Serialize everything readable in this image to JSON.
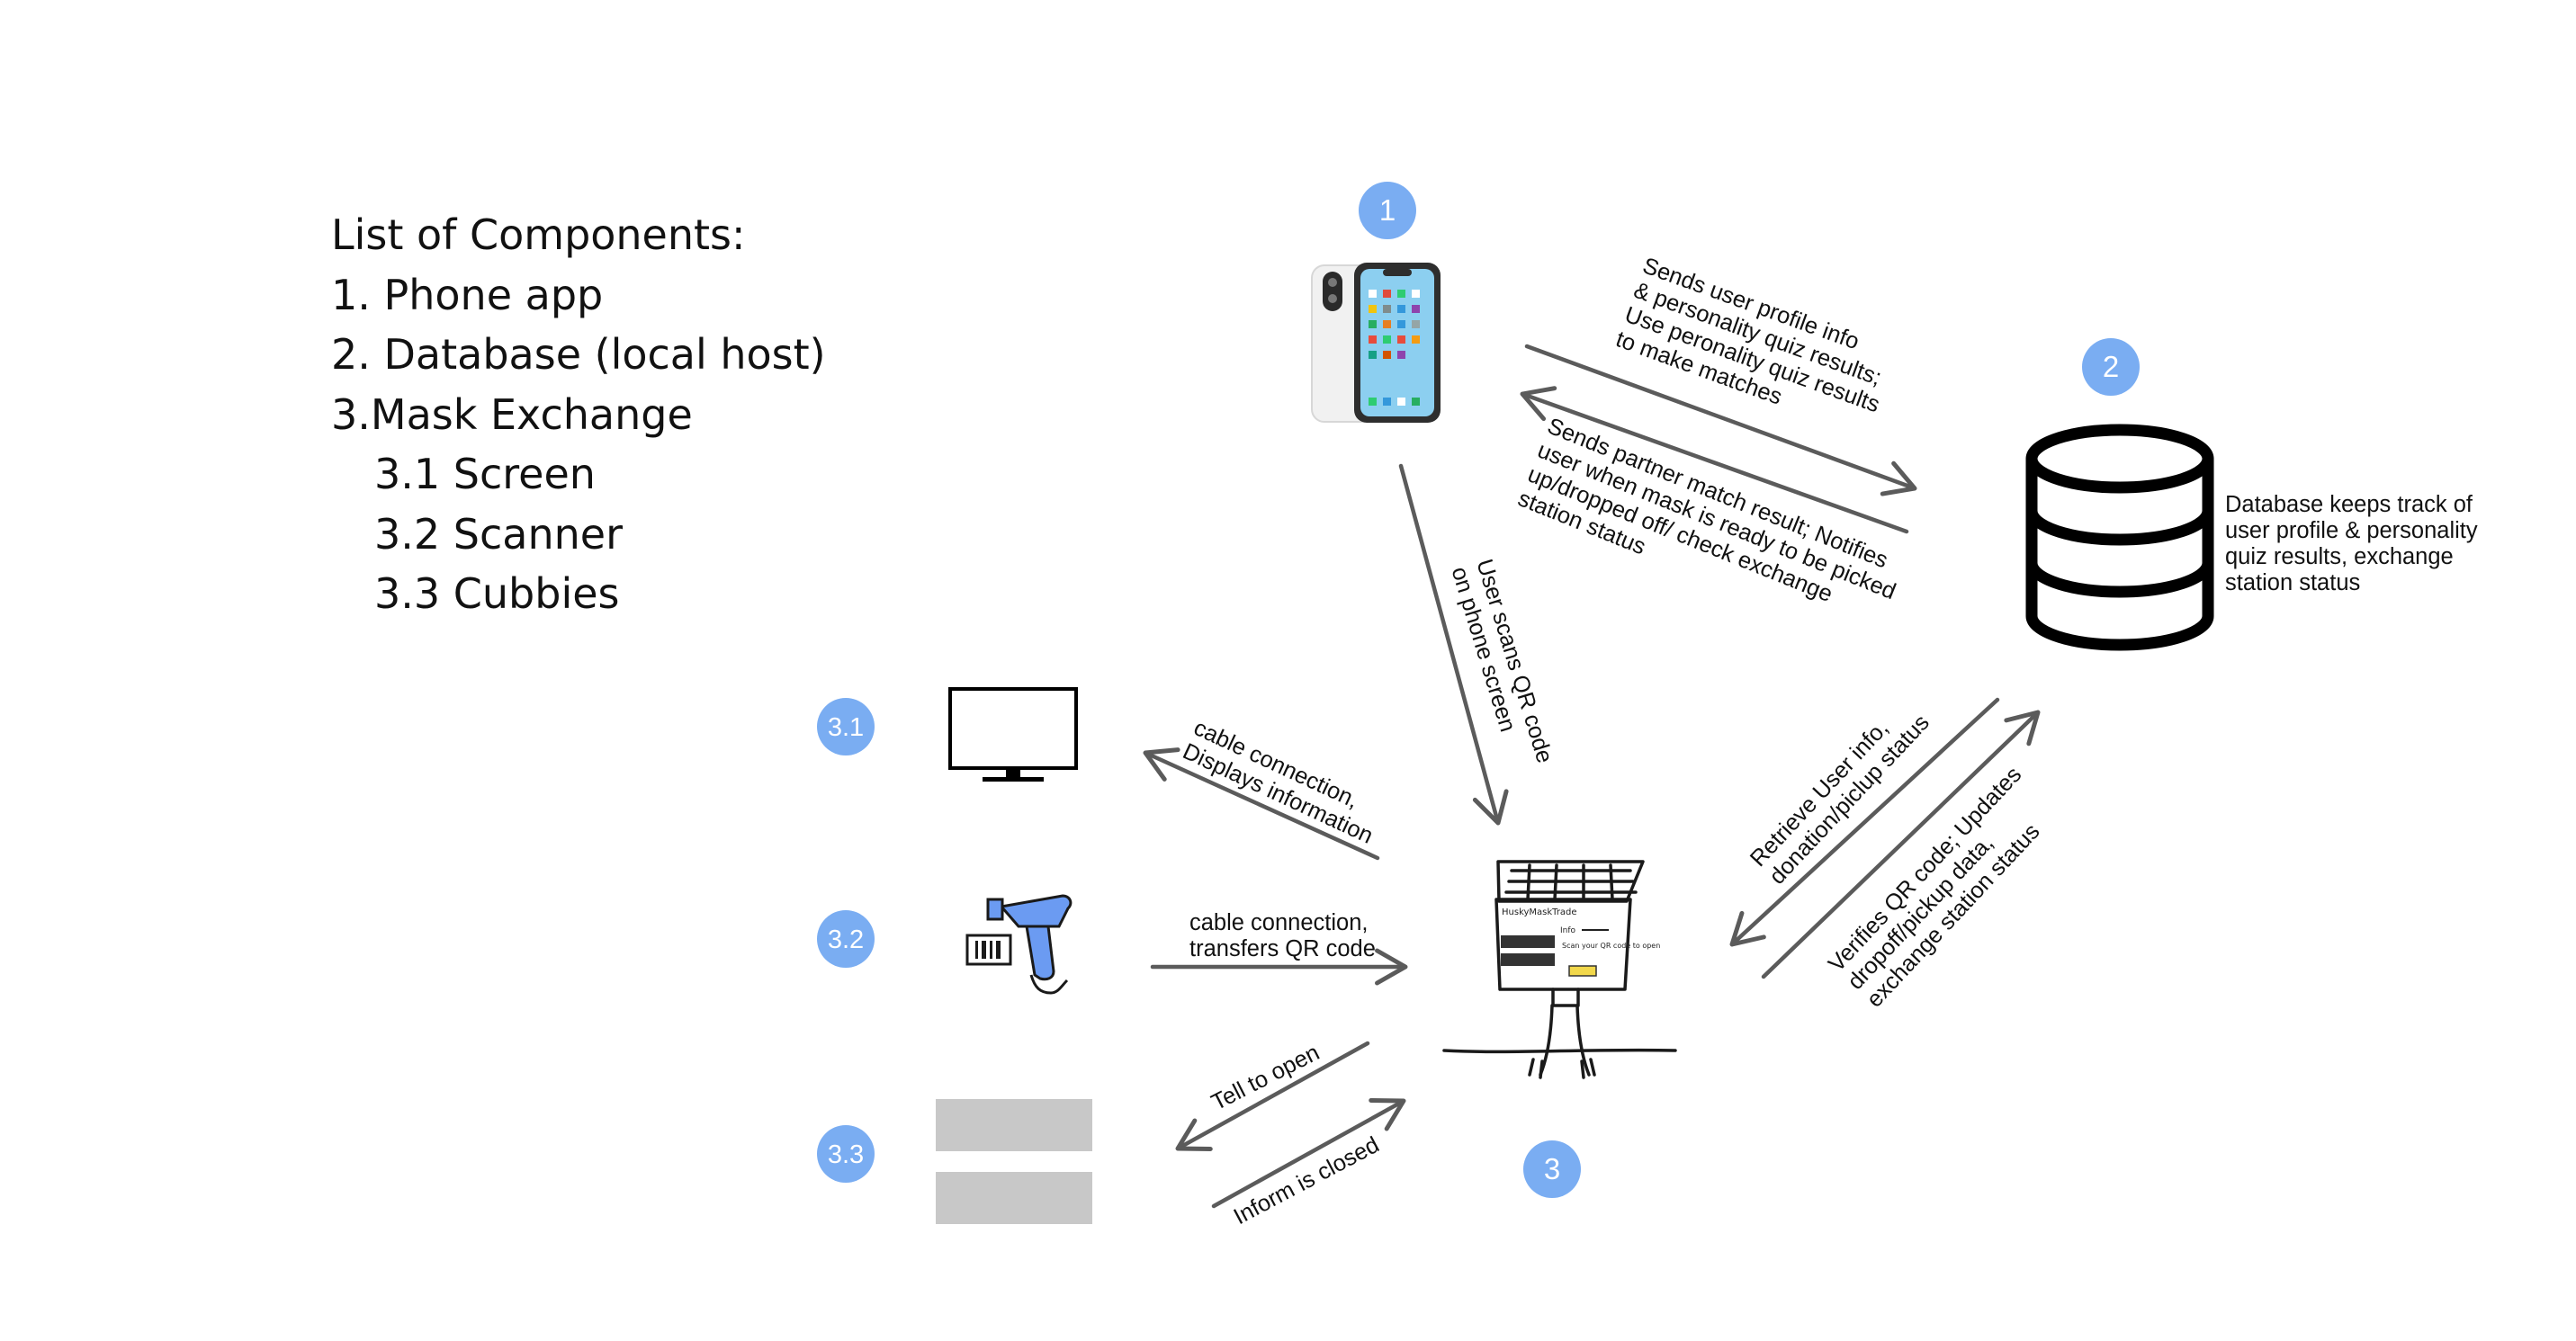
{
  "components": {
    "heading": "List of Components:",
    "items": [
      "1. Phone app",
      "2. Database (local host)",
      "3.Mask Exchange",
      "3.1 Screen",
      "3.2 Scanner",
      "3.3 Cubbies"
    ]
  },
  "badges": {
    "phone": "1",
    "database": "2",
    "exchange": "3",
    "screen": "3.1",
    "scanner": "3.2",
    "cubbies": "3.3"
  },
  "exchange_sign": {
    "title": "HuskyMaskTrade",
    "info": "Info",
    "scan": "Scan your QR code to open"
  },
  "labels": {
    "phone_to_db": [
      "Sends user profile info",
      "& personality quiz results;",
      "Use peronality quiz results",
      "to make matches"
    ],
    "db_to_phone": [
      "Sends partner match result; Notifies",
      "user when mask is ready to be picked",
      "up/dropped off/ check exchange",
      "station status"
    ],
    "db_note": [
      "Database keeps track of",
      "user profile & personality",
      "quiz results, exchange",
      "station status"
    ],
    "phone_to_exchange": [
      "User scans QR code",
      "on phone screen"
    ],
    "db_to_exchange": [
      "Retrieve User info,",
      "donation/piclup status"
    ],
    "exchange_to_db": [
      "Verifies QR code; Updates",
      "dropoff/pickup data,",
      "exchange station status"
    ],
    "exchange_to_screen": [
      "cable connection,",
      "Displays information"
    ],
    "scanner_to_exchange": [
      "cable connection,",
      "transfers QR code"
    ],
    "exchange_to_cubbies": [
      "Tell to open"
    ],
    "cubbies_to_exchange": [
      "Inform is closed"
    ]
  },
  "colors": {
    "badge": "#7aadf2",
    "arrow": "#5b5b5b",
    "cubby": "#c8c8c8",
    "scanner": "#6b9bf2",
    "text": "#111111"
  }
}
